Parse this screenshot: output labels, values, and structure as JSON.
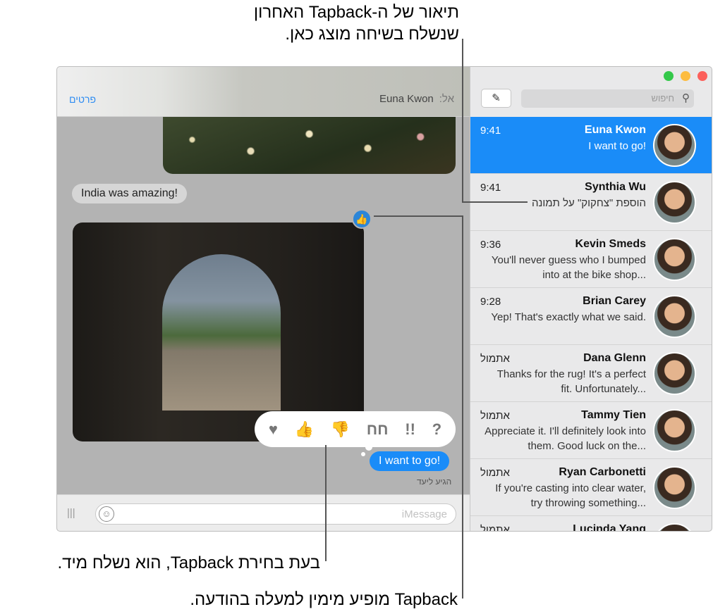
{
  "callouts": {
    "top": [
      "תיאור של ה-Tapback האחרון",
      "שנשלח בשיחה מוצג כאן."
    ],
    "bottom1": "בעת בחירת Tapback, הוא נשלח מיד.",
    "bottom2": "Tapback מופיע מימין למעלה בהודעה."
  },
  "conversation": {
    "details_label": "פרטים",
    "to_label": "אל:",
    "recipient": "Euna Kwon",
    "incoming_text": "India was amazing!",
    "outgoing_text": "I want to go!",
    "delivered": "הגיע ליעד",
    "tapback_badge": "thumbs-up-icon",
    "tapbacks": [
      {
        "icon": "heart-icon",
        "glyph": "♥"
      },
      {
        "icon": "thumbs-up-icon",
        "glyph": "👍"
      },
      {
        "icon": "thumbs-down-icon",
        "glyph": "👎"
      },
      {
        "icon": "haha-icon",
        "glyph": "חח"
      },
      {
        "icon": "exclamation-icon",
        "glyph": "!!"
      },
      {
        "icon": "question-icon",
        "glyph": "?"
      }
    ],
    "input_placeholder": "iMessage"
  },
  "sidebar": {
    "search_placeholder": "חיפוש",
    "colors": {
      "selected": "#1a8cf8",
      "close": "#fc605b",
      "minimize": "#fdbc40",
      "zoom": "#34c84a"
    },
    "conversations": [
      {
        "name": "Euna Kwon",
        "time": "9:41",
        "preview": "I want to go!"
      },
      {
        "name": "Synthia Wu",
        "time": "9:41",
        "preview": "הוספת \"צחקוק\" על תמונה"
      },
      {
        "name": "Kevin Smeds",
        "time": "9:36",
        "preview": "You'll never guess who I bumped into at the bike shop..."
      },
      {
        "name": "Brian Carey",
        "time": "9:28",
        "preview": "Yep! That's exactly what we said."
      },
      {
        "name": "Dana Glenn",
        "time": "אתמול",
        "preview": "Thanks for the rug! It's a perfect fit. Unfortunately..."
      },
      {
        "name": "Tammy Tien",
        "time": "אתמול",
        "preview": "Appreciate it. I'll definitely look into them. Good luck on the..."
      },
      {
        "name": "Ryan Carbonetti",
        "time": "אתמול",
        "preview": "If you're casting into clear water, try throwing something..."
      },
      {
        "name": "Lucinda Yang",
        "time": "אתמול",
        "preview": ""
      }
    ]
  }
}
